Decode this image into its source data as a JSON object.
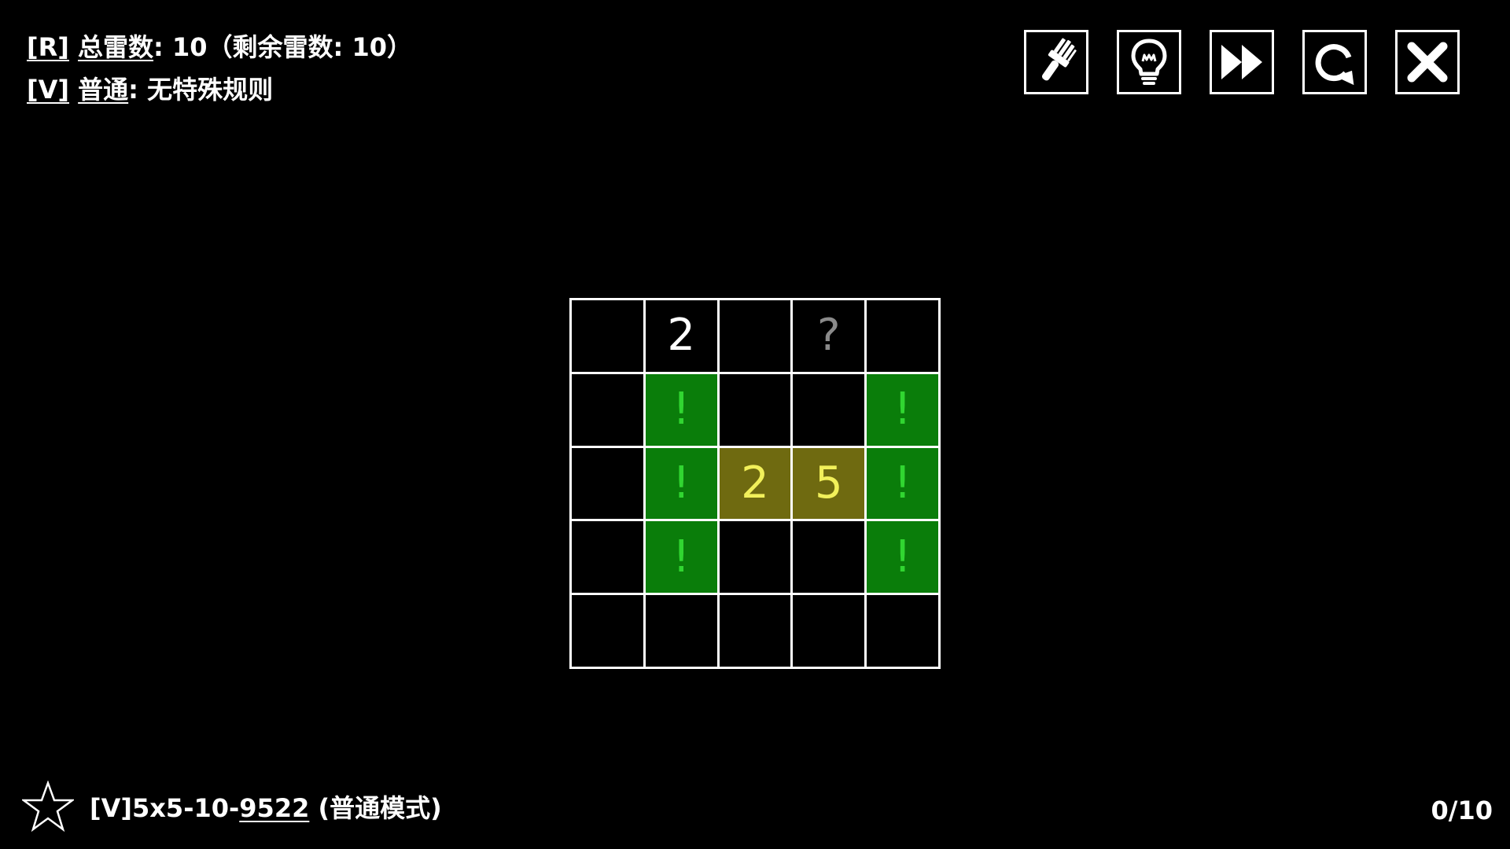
{
  "header": {
    "total_mines_tag": "[R]",
    "total_mines_label": "总雷数",
    "total_mines_value": ":  10（剩余雷数: 10）",
    "rule_tag": "[V]",
    "rule_name": "普通",
    "rule_desc": ": 无特殊规则"
  },
  "toolbar": {
    "buttons": [
      {
        "name": "clear-brush",
        "icon": "brush-icon"
      },
      {
        "name": "hint",
        "icon": "lightbulb-icon"
      },
      {
        "name": "skip",
        "icon": "fast-forward-icon"
      },
      {
        "name": "restart",
        "icon": "refresh-icon"
      },
      {
        "name": "close",
        "icon": "close-icon"
      }
    ]
  },
  "board": {
    "rows": 5,
    "cols": 5,
    "cells": [
      [
        {
          "t": "",
          "s": "empty"
        },
        {
          "t": "2",
          "s": "number"
        },
        {
          "t": "",
          "s": "empty"
        },
        {
          "t": "?",
          "s": "unknown"
        },
        {
          "t": "",
          "s": "empty"
        }
      ],
      [
        {
          "t": "",
          "s": "empty"
        },
        {
          "t": "!",
          "s": "mine"
        },
        {
          "t": "",
          "s": "empty"
        },
        {
          "t": "",
          "s": "empty"
        },
        {
          "t": "!",
          "s": "mine"
        }
      ],
      [
        {
          "t": "",
          "s": "empty"
        },
        {
          "t": "!",
          "s": "mine"
        },
        {
          "t": "2",
          "s": "hint"
        },
        {
          "t": "5",
          "s": "hint"
        },
        {
          "t": "!",
          "s": "mine"
        }
      ],
      [
        {
          "t": "",
          "s": "empty"
        },
        {
          "t": "!",
          "s": "mine"
        },
        {
          "t": "",
          "s": "empty"
        },
        {
          "t": "",
          "s": "empty"
        },
        {
          "t": "!",
          "s": "mine"
        }
      ],
      [
        {
          "t": "",
          "s": "empty"
        },
        {
          "t": "",
          "s": "empty"
        },
        {
          "t": "",
          "s": "empty"
        },
        {
          "t": "",
          "s": "empty"
        },
        {
          "t": "",
          "s": "empty"
        }
      ]
    ]
  },
  "colors": {
    "background": "#000000",
    "mine_fill": "#0a7d0a",
    "mine_mark": "#31d631",
    "hint_fill": "#6f6a10",
    "hint_text": "#f2f05a"
  },
  "footer": {
    "star_icon": "star-outline-icon",
    "puzzle_prefix": "[V]5x5-10-",
    "puzzle_seed": "9522",
    "puzzle_mode": " (普通模式)",
    "progress": "0/10"
  }
}
